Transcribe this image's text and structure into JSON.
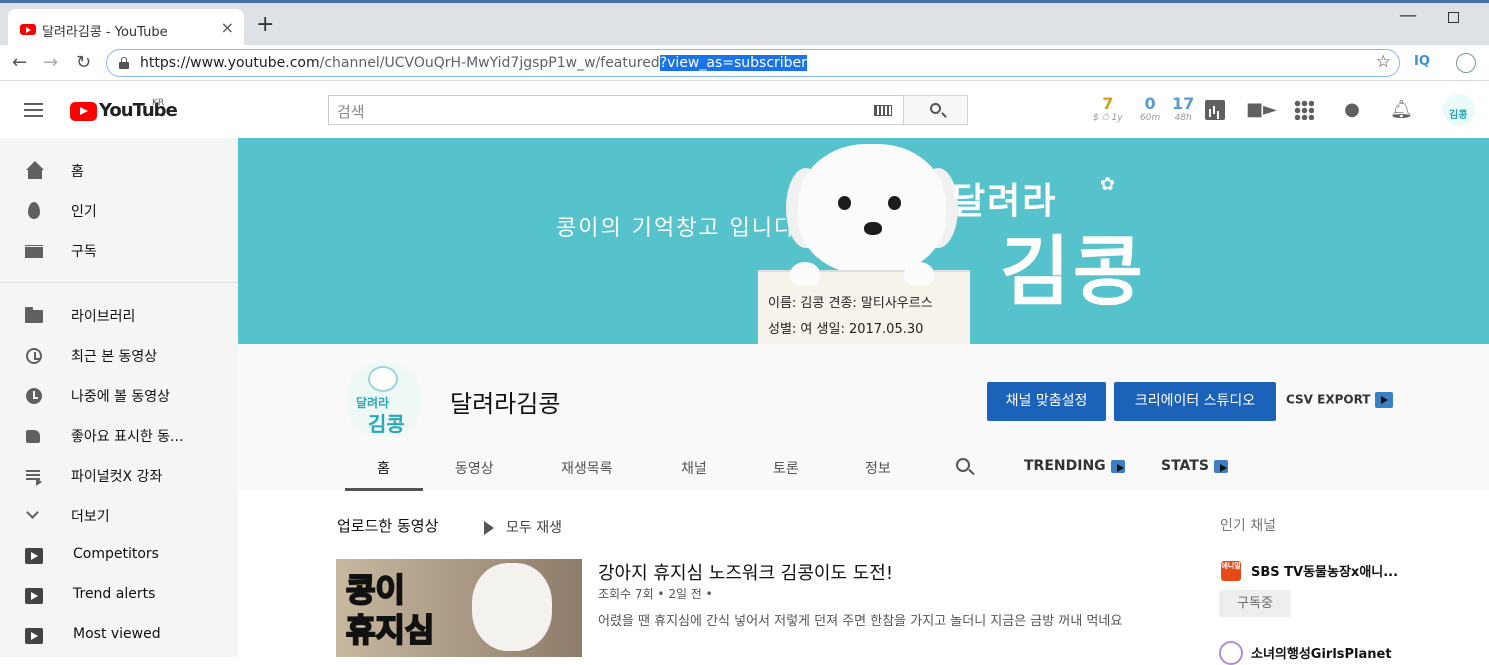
{
  "browser": {
    "tab_title": "달려라김콩 - YouTube",
    "tab_close": "×",
    "new_tab": "+",
    "url_base": "https://www.youtube.com",
    "url_path": "/channel/UCVOuQrH-MwYid7jgspP1w_w/featured",
    "url_selected": "?view_as=subscriber",
    "ext_iq": "IQ"
  },
  "header": {
    "logo_text": "YouTube",
    "region": "KR",
    "search_placeholder": "검색",
    "stats": [
      {
        "value": "7",
        "label": "$ ⏱ 1y",
        "color": "#d4a017"
      },
      {
        "value": "0",
        "label": "60m",
        "color": "#5b9bd5"
      },
      {
        "value": "17",
        "label": "48h",
        "color": "#5b9bd5"
      }
    ],
    "avatar_text": "김콩"
  },
  "sidebar": {
    "items": [
      {
        "label": "홈"
      },
      {
        "label": "인기"
      },
      {
        "label": "구독"
      },
      {
        "label": "라이브러리"
      },
      {
        "label": "최근 본 동영상"
      },
      {
        "label": "나중에 볼 동영상"
      },
      {
        "label": "좋아요 표시한 동..."
      },
      {
        "label": "파이널컷X 강좌"
      },
      {
        "label": "더보기"
      },
      {
        "label": "Competitors"
      },
      {
        "label": "Trend alerts"
      },
      {
        "label": "Most viewed"
      }
    ]
  },
  "banner": {
    "tagline": "콩이의 기억창고 입니다",
    "sign_line1": "이름: 김콩   견종: 말티사우르스",
    "sign_line2": "성별: 여     생일: 2017.05.30",
    "logo_small": "달려라",
    "logo_big": "김콩"
  },
  "channel": {
    "name": "달려라김콩",
    "avatar_small": "달려라",
    "avatar_big": "김콩",
    "customize_label": "채널 맞춤설정",
    "studio_label": "크리에이터 스튜디오",
    "csv_label": "CSV EXPORT",
    "tabs": [
      {
        "label": "홈"
      },
      {
        "label": "동영상"
      },
      {
        "label": "재생목록"
      },
      {
        "label": "채널"
      },
      {
        "label": "토론"
      },
      {
        "label": "정보"
      },
      {
        "label": "TRENDING"
      },
      {
        "label": "STATS"
      }
    ]
  },
  "content": {
    "section_title": "업로드한 동영상",
    "play_all": "모두 재생",
    "video": {
      "thumb_line1": "콩이",
      "thumb_line2": "휴지심",
      "title": "강아지 휴지심 노즈워크 김콩이도 도전!",
      "meta": "조회수 7회 • 2일 전 •",
      "description": "어렸을 땐 휴지심에 간식 넣어서 저렇게 던져 주면 한참을 가지고 놀더니 지금은 금방 꺼내 먹네요"
    },
    "popular": {
      "title": "인기 채널",
      "channels": [
        {
          "logo": "애니멀",
          "name": "SBS TV동물농장x애니...",
          "subscribe": "구독중"
        },
        {
          "name": "소녀의행성GirlsPlanet"
        }
      ]
    }
  }
}
